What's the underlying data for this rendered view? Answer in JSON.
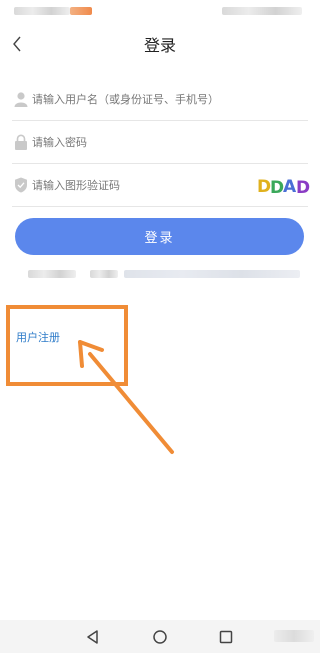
{
  "header": {
    "title": "登录"
  },
  "form": {
    "username_placeholder": "请输入用户名（或身份证号、手机号）",
    "password_placeholder": "请输入密码",
    "captcha_placeholder": "请输入图形验证码",
    "captcha_text": "DDAD"
  },
  "login_button_label": "登录",
  "register_link_label": "用户注册",
  "colors": {
    "primary_button": "#5b87ec",
    "link": "#2f7cc9",
    "annotation": "#f08c36"
  },
  "icons": {
    "back": "chevron-left-icon",
    "username": "user-icon",
    "password": "lock-icon",
    "captcha": "shield-icon",
    "nav_back": "triangle-back-icon",
    "nav_home": "circle-home-icon",
    "nav_recent": "square-recent-icon"
  }
}
